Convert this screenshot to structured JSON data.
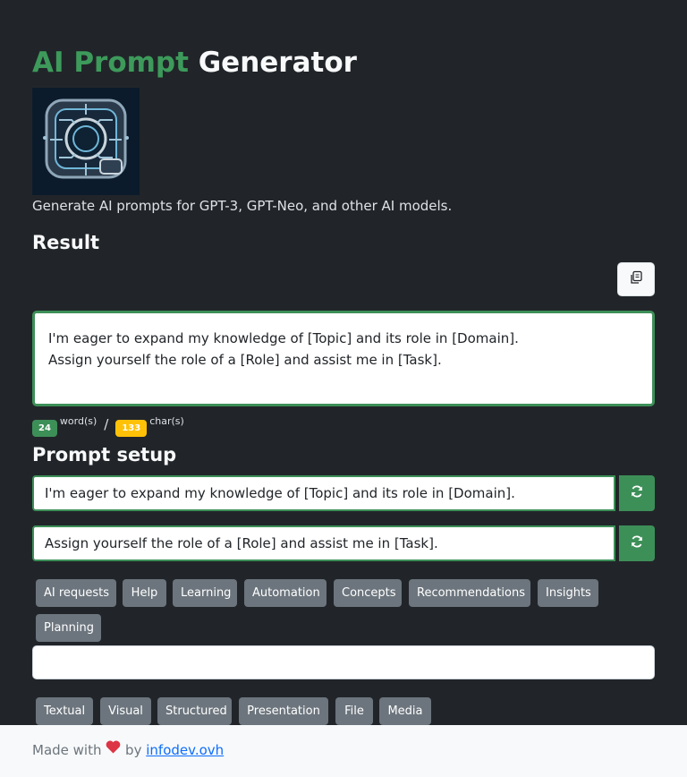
{
  "header": {
    "title_accent": "AI Prompt",
    "title_rest": "Generator",
    "tagline": "Generate AI prompts for GPT-3, GPT-Neo, and other AI models."
  },
  "result": {
    "heading": "Result",
    "line1": "I'm eager to expand my knowledge of [Topic] and its role in [Domain].",
    "line2": "Assign yourself the role of a [Role] and assist me in [Task].",
    "words_count": "24",
    "words_label": "word(s)",
    "separator": "/",
    "chars_count": "133",
    "chars_label": "char(s)"
  },
  "setup": {
    "heading": "Prompt setup",
    "field1": "I'm eager to expand my knowledge of [Topic] and its role in [Domain].",
    "field2": "Assign yourself the role of a [Role] and assist me in [Task].",
    "categories": [
      "AI requests",
      "Help",
      "Learning",
      "Automation",
      "Concepts",
      "Recommendations",
      "Insights",
      "Planning"
    ],
    "formats": [
      "Textual",
      "Visual",
      "Structured",
      "Presentation",
      "File",
      "Media"
    ]
  },
  "footer": {
    "made_with": "Made with",
    "by": "by",
    "link": "infodev.ovh"
  },
  "icons": {
    "copy": "copy-icon",
    "refresh": "refresh-icon",
    "heart": "heart-icon"
  },
  "colors": {
    "accent": "#3d9a5b",
    "background": "#212529",
    "chip": "#6c757d",
    "chars_badge": "#ffc107"
  }
}
